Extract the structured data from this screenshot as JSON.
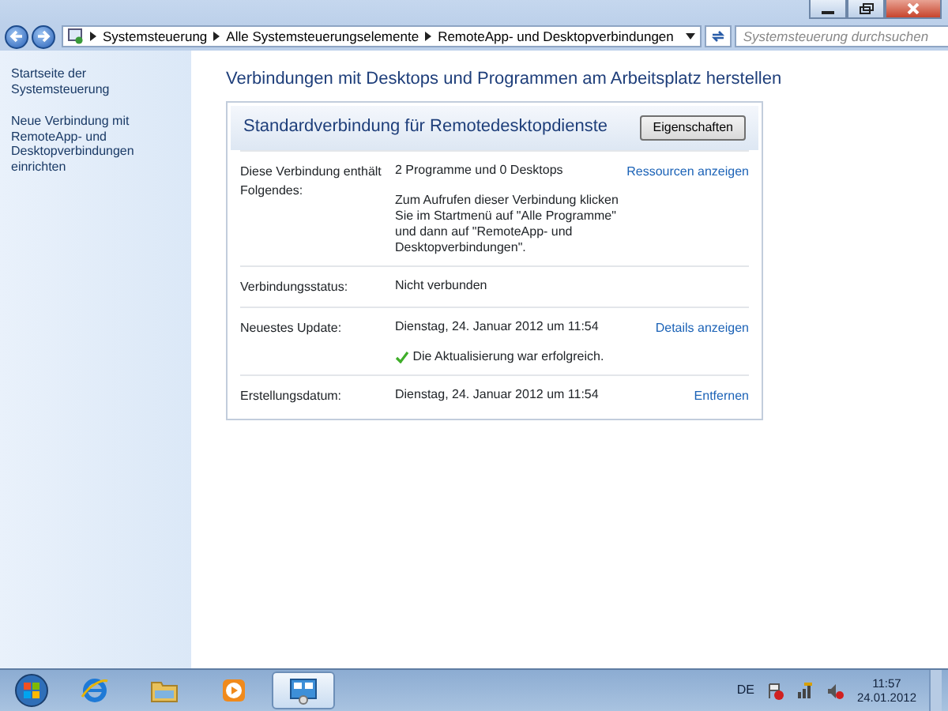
{
  "address": {
    "crumbs": [
      "Systemsteuerung",
      "Alle Systemsteuerungselemente",
      "RemoteApp- und Desktopverbindungen"
    ]
  },
  "search": {
    "placeholder": "Systemsteuerung durchsuchen"
  },
  "sidebar": {
    "links": [
      "Startseite der Systemsteuerung",
      "Neue Verbindung mit RemoteApp- und Desktopverbindungen einrichten"
    ]
  },
  "main": {
    "heading": "Verbindungen mit Desktops und Programmen am Arbeitsplatz herstellen",
    "connection": {
      "title": "Standardverbindung für Remotedesktopdienste",
      "button": "Eigenschaften",
      "rows": [
        {
          "label": "Diese Verbindung enthält Folgendes:",
          "link": "Ressourcen anzeigen",
          "lines": [
            {
              "kind": "text",
              "text": "2 Programme und 0 Desktops"
            },
            {
              "kind": "text",
              "text": "Zum Aufrufen dieser Verbindung klicken Sie im Startmenü auf \"Alle Programme\" und dann auf \"RemoteApp- und Desktopverbindungen\"."
            }
          ]
        },
        {
          "label": "Verbindungsstatus:",
          "lines": [
            {
              "kind": "text",
              "text": "Nicht verbunden"
            }
          ]
        },
        {
          "label": "Neuestes Update:",
          "link": "Details anzeigen",
          "lines": [
            {
              "kind": "text",
              "text": "Dienstag, 24. Januar 2012 um 11:54"
            },
            {
              "kind": "success",
              "text": "Die Aktualisierung war erfolgreich."
            }
          ]
        },
        {
          "label": "Erstellungsdatum:",
          "link": "Entfernen",
          "lines": [
            {
              "kind": "text",
              "text": "Dienstag, 24. Januar 2012 um 11:54"
            }
          ]
        }
      ]
    }
  },
  "taskbar": {
    "apps": [
      {
        "kind": "browser",
        "selected": false
      },
      {
        "kind": "folder",
        "selected": false
      },
      {
        "kind": "media",
        "selected": false
      },
      {
        "kind": "control-panel",
        "selected": true
      }
    ],
    "language": "DE",
    "time": "11:57",
    "date": "24.01.2012"
  }
}
